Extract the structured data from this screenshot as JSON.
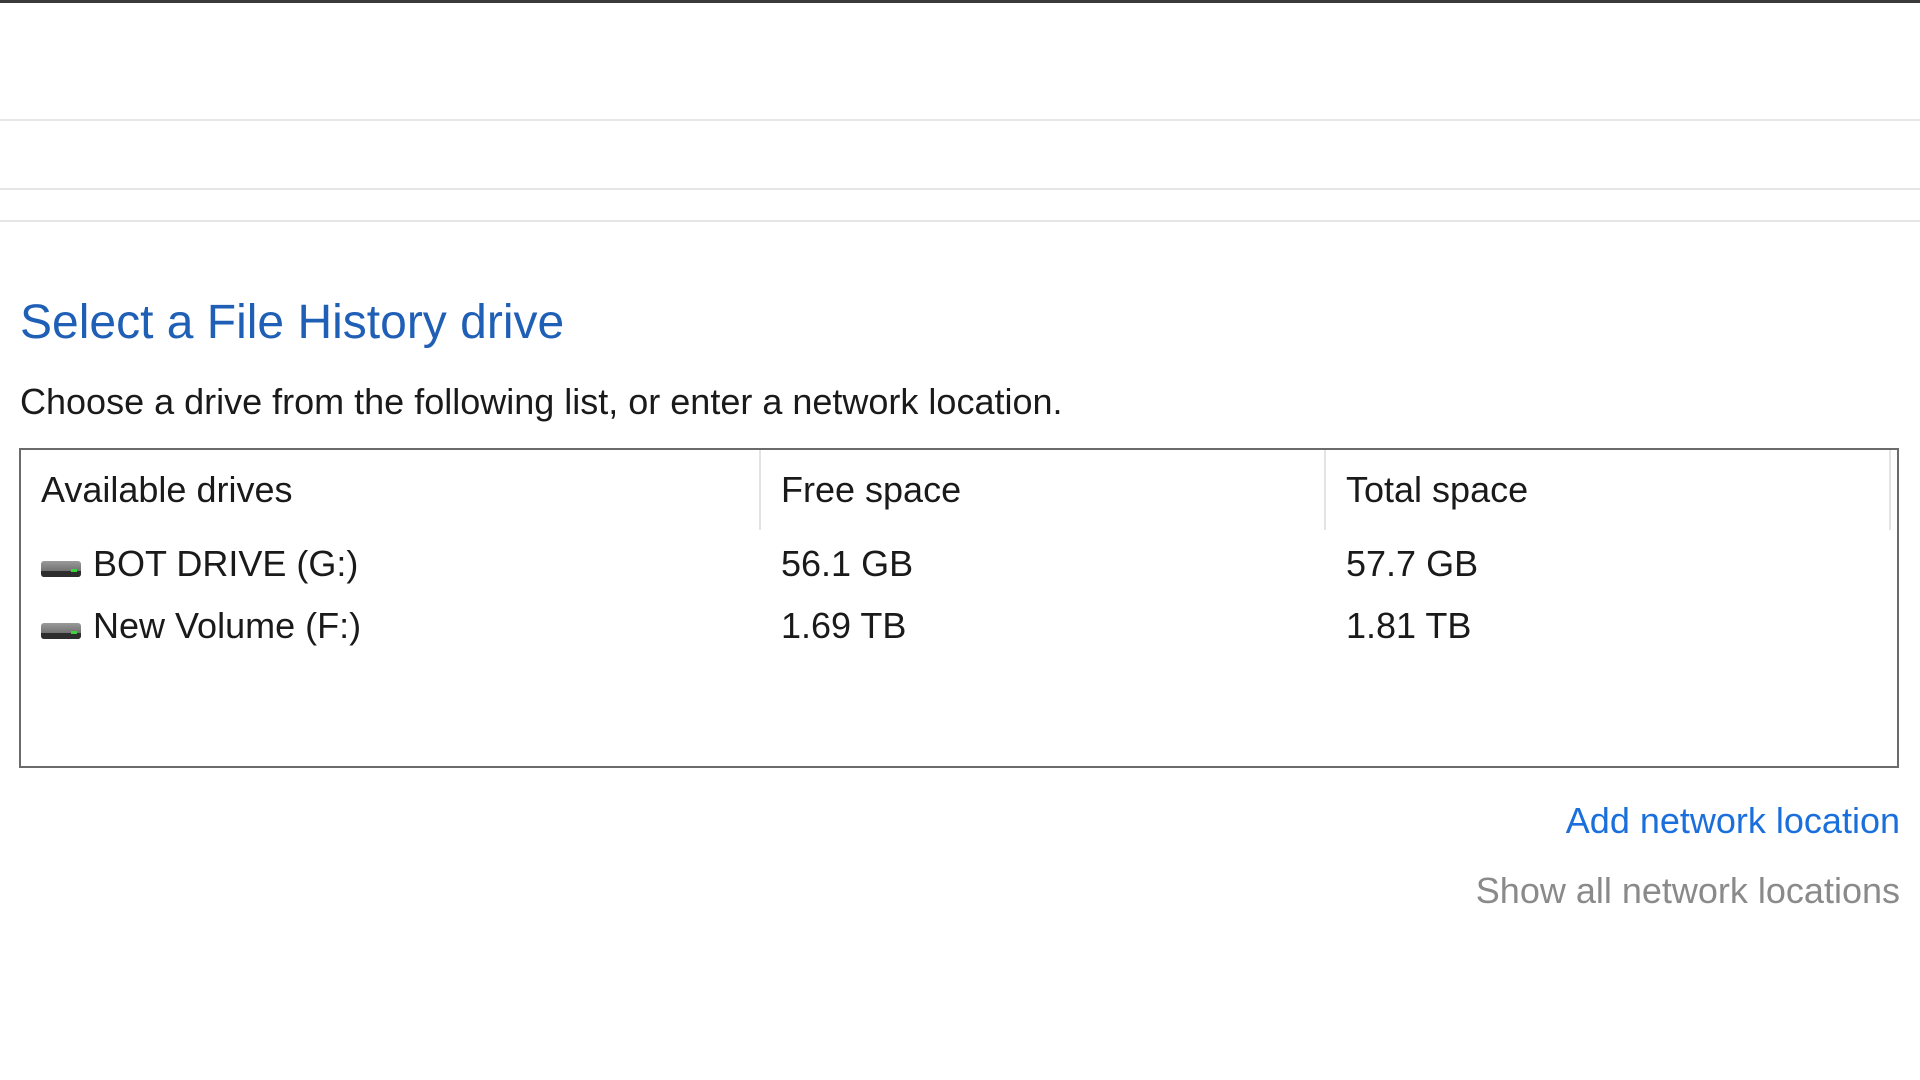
{
  "heading": {
    "title": "Select a File History drive",
    "subtitle": "Choose a drive from the following list, or enter a network location."
  },
  "drive_list": {
    "columns": [
      "Available drives",
      "Free space",
      "Total space"
    ],
    "rows": [
      {
        "name": "BOT DRIVE (G:)",
        "free": "56.1 GB",
        "total": "57.7 GB",
        "icon": "hard-drive-icon"
      },
      {
        "name": "New Volume (F:)",
        "free": "1.69 TB",
        "total": "1.81 TB",
        "icon": "hard-drive-icon"
      }
    ]
  },
  "links": {
    "add_network": "Add network location",
    "show_all": "Show all network locations"
  },
  "colors": {
    "title": "#1f5fb6",
    "link": "#1a6fdc",
    "disabled_link": "#8a8a8a"
  }
}
